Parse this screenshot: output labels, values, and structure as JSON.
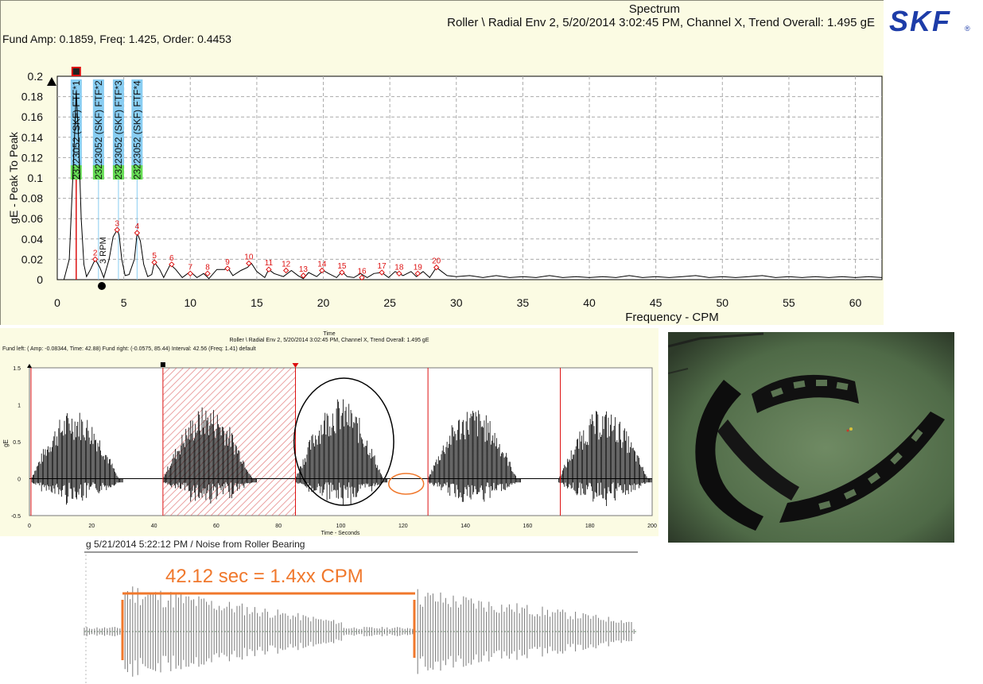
{
  "spectrum": {
    "title": "Spectrum",
    "subtitle": "Roller \\ Radial Env 2, 5/20/2014 3:02:45 PM, Channel X, Trend Overall: 1.495 gE",
    "readout": "Fund Amp: 0.1859, Freq: 1.425, Order: 0.4453"
  },
  "logo": {
    "text": "SKF",
    "mark": "®",
    "color": "#1d3ca8"
  },
  "colors": {
    "spectrum_line": "#000000",
    "marker_red": "#dd1111",
    "label_blue": "#88cdf2",
    "label_green": "#66dd55",
    "annotation_orange": "#f0782c",
    "panel_bg": "#fbfbe3"
  },
  "chart_data": [
    {
      "type": "line",
      "ylabel": "gE - Peak To Peak",
      "xlabel": "Frequency - CPM",
      "xlim": [
        0,
        62
      ],
      "ylim": [
        0,
        0.2
      ],
      "x_ticks": [
        "0",
        "5",
        "10",
        "15",
        "20",
        "25",
        "30",
        "35",
        "40",
        "45",
        "50",
        "55",
        "60"
      ],
      "y_ticks": [
        "0",
        "0.02",
        "0.04",
        "0.06",
        "0.08",
        "0.1",
        "0.12",
        "0.14",
        "0.16",
        "0.18",
        "0.2"
      ],
      "grid": true,
      "series": [
        {
          "x": [
            0,
            0.5,
            0.9,
            1.1,
            1.3,
            1.425,
            1.6,
            1.8,
            2.0,
            2.2,
            2.5,
            2.85,
            3.2,
            3.5,
            3.9,
            4.2,
            4.5,
            4.65,
            4.85,
            5.1,
            5.4,
            5.8,
            6.0,
            6.25,
            6.5,
            6.8,
            7.1,
            7.3,
            7.7,
            8.0,
            8.5,
            8.9,
            9.4,
            10.0,
            10.5,
            11.0,
            11.4,
            12.0,
            12.6,
            12.8,
            13.2,
            13.8,
            14.3,
            14.6,
            15.0,
            15.6,
            15.9,
            16.3,
            17.0,
            17.6,
            18.1,
            18.5,
            18.9,
            19.5,
            20.0,
            20.4,
            21.0,
            21.4,
            21.8,
            22.3,
            22.8,
            23.3,
            23.8,
            24.4,
            24.9,
            25.4,
            26.0,
            26.6,
            27.0,
            27.5,
            28.0,
            28.5,
            28.9,
            29.3,
            30.0,
            31.0,
            32.0,
            33.0,
            34.0,
            35.0,
            36.0,
            37.0,
            38.0,
            39.0,
            40.0,
            41.0,
            42.0,
            43.0,
            44.0,
            45.0,
            46.0,
            47.0,
            48.0,
            49.0,
            50.0,
            51.0,
            52.0,
            53.0,
            54.0,
            55.0,
            56.0,
            57.0,
            58.0,
            59.0,
            60.0,
            61.0,
            62.0
          ],
          "y": [
            0,
            0.0,
            0.02,
            0.08,
            0.14,
            0.185,
            0.14,
            0.06,
            0.015,
            0.003,
            0.01,
            0.02,
            0.012,
            0.002,
            0.02,
            0.042,
            0.049,
            0.044,
            0.02,
            0.004,
            0.005,
            0.02,
            0.046,
            0.038,
            0.015,
            0.003,
            0.005,
            0.017,
            0.01,
            0.002,
            0.015,
            0.01,
            0.002,
            0.008,
            0.002,
            0.006,
            0.001,
            0.01,
            0.01,
            0.012,
            0.004,
            0.009,
            0.012,
            0.016,
            0.008,
            0.002,
            0.01,
            0.006,
            0.003,
            0.009,
            0.004,
            0.001,
            0.007,
            0.003,
            0.009,
            0.006,
            0.002,
            0.008,
            0.003,
            0.002,
            0.006,
            0.002,
            0.006,
            0.007,
            0.002,
            0.008,
            0.004,
            0.008,
            0.003,
            0.008,
            0.002,
            0.012,
            0.008,
            0.004,
            0.003,
            0.004,
            0.002,
            0.004,
            0.002,
            0.003,
            0.002,
            0.004,
            0.002,
            0.003,
            0.002,
            0.003,
            0.002,
            0.004,
            0.002,
            0.003,
            0.002,
            0.003,
            0.004,
            0.002,
            0.003,
            0.002,
            0.003,
            0.004,
            0.002,
            0.003,
            0.002,
            0.003,
            0.002,
            0.003,
            0.002,
            0.003,
            0.002
          ]
        }
      ],
      "peaks": [
        {
          "label": "2",
          "x": 2.85,
          "y": 0.02
        },
        {
          "label": "3",
          "x": 4.5,
          "y": 0.049
        },
        {
          "label": "4",
          "x": 6.0,
          "y": 0.046
        },
        {
          "label": "5",
          "x": 7.3,
          "y": 0.017
        },
        {
          "label": "6",
          "x": 8.6,
          "y": 0.015
        },
        {
          "label": "7",
          "x": 10.0,
          "y": 0.006
        },
        {
          "label": "8",
          "x": 11.3,
          "y": 0.006
        },
        {
          "label": "9",
          "x": 12.8,
          "y": 0.011
        },
        {
          "label": "10",
          "x": 14.4,
          "y": 0.016
        },
        {
          "label": "11",
          "x": 15.9,
          "y": 0.01
        },
        {
          "label": "12",
          "x": 17.2,
          "y": 0.009
        },
        {
          "label": "13",
          "x": 18.5,
          "y": 0.004
        },
        {
          "label": "14",
          "x": 19.9,
          "y": 0.009
        },
        {
          "label": "15",
          "x": 21.4,
          "y": 0.007
        },
        {
          "label": "16",
          "x": 22.9,
          "y": 0.002
        },
        {
          "label": "17",
          "x": 24.4,
          "y": 0.007
        },
        {
          "label": "18",
          "x": 25.7,
          "y": 0.006
        },
        {
          "label": "19",
          "x": 27.1,
          "y": 0.006
        },
        {
          "label": "20",
          "x": 28.5,
          "y": 0.012
        }
      ],
      "fault_frequencies": [
        {
          "label": "23223052 (SKF) FTF*1",
          "x": 1.425
        },
        {
          "label": "23223052 (SKF) FTF*2",
          "x": 3.1
        },
        {
          "label": "23223052 (SKF) FTF*3",
          "x": 4.6
        },
        {
          "label": "23223052 (SKF) FTF*4",
          "x": 6.0
        }
      ],
      "annotations": [
        "3 RPM"
      ]
    },
    {
      "type": "line",
      "title": "Time",
      "subtitle": "Roller \\ Radial Env 2, 5/20/2014 3:02:45 PM, Channel X, Trend Overall: 1.495 gE",
      "readout": "Fund left: ( Amp: -0.08344, Time: 42.88) Fund right: (-0.0575, 85.44) Interval: 42.56 (Freq: 1.41) default",
      "xlabel": "Time - Seconds",
      "ylabel": "gE",
      "xlim": [
        0,
        200
      ],
      "ylim": [
        -0.5,
        1.5
      ],
      "x_ticks": [
        "0",
        "20",
        "40",
        "60",
        "80",
        "100",
        "120",
        "140",
        "160",
        "180",
        "200"
      ],
      "y_ticks": [
        "-0.5",
        "0",
        "0.5",
        "1",
        "1.5"
      ],
      "bursts": [
        {
          "start": 0.5,
          "end": 30,
          "peak": 0.95
        },
        {
          "start": 42.88,
          "end": 73,
          "peak": 1.0
        },
        {
          "start": 85.44,
          "end": 115,
          "peak": 1.1
        },
        {
          "start": 128,
          "end": 158,
          "peak": 0.98
        },
        {
          "start": 170,
          "end": 200,
          "peak": 0.95
        }
      ],
      "highlight_interval": [
        42.88,
        85.44
      ],
      "cursor_lines": [
        0.5,
        42.88,
        85.44,
        128,
        170.5
      ],
      "grid": false
    }
  ],
  "noise": {
    "header": "g   5/21/2014 5:22:12 PM / Noise from Roller Bearing",
    "annotation": "42.12 sec = 1.4xx CPM"
  }
}
